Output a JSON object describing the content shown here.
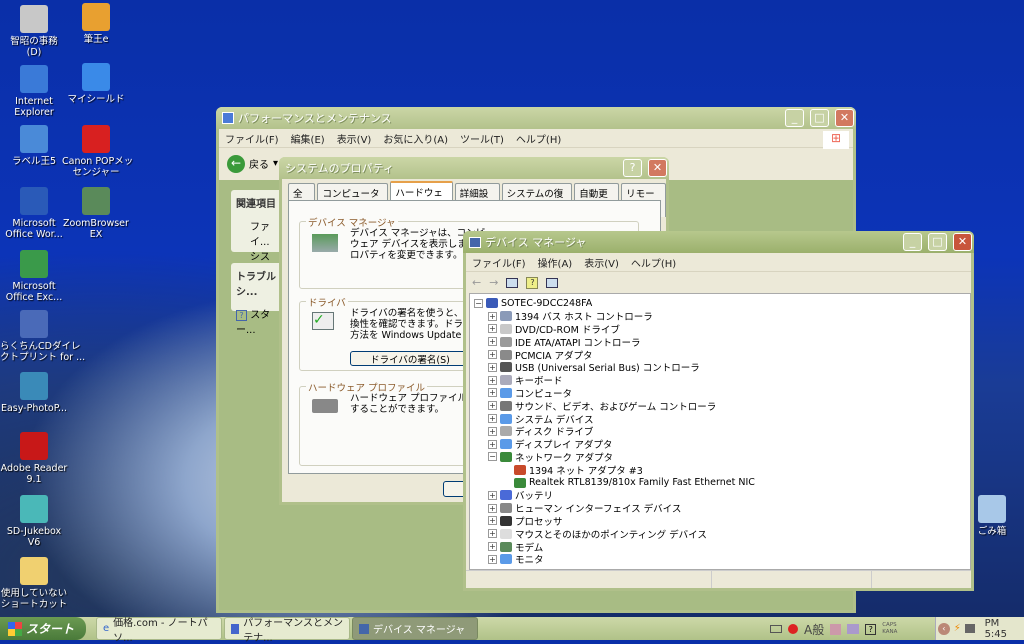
{
  "desktop_icons": [
    {
      "label": "智昭の事務\n(D)",
      "color": "#c8c8c8"
    },
    {
      "label": "Internet\nExplorer",
      "color": "#3a7ad8"
    },
    {
      "label": "ラベル王5",
      "color": "#4a8ad8"
    },
    {
      "label": "Microsoft\nOffice Wor...",
      "color": "#2a5ab8"
    },
    {
      "label": "Microsoft\nOffice Exc...",
      "color": "#3a9a4a"
    },
    {
      "label": "らくちんCDダイレ\nクトプリント for ...",
      "color": "#4a6ab8"
    },
    {
      "label": "Easy-PhotoP...",
      "color": "#3a8ab8"
    },
    {
      "label": "Adobe Reader\n9.1",
      "color": "#c81818"
    },
    {
      "label": "SD-Jukebox\nV6",
      "color": "#4ab8b8"
    },
    {
      "label": "使用していない\nショートカット",
      "color": "#f0d070"
    },
    {
      "label": "筆王e",
      "color": "#e8a030"
    },
    {
      "label": "マイシールド",
      "color": "#3a8ae8"
    },
    {
      "label": "Canon POPメッ\nセンジャー",
      "color": "#d82020"
    },
    {
      "label": "ZoomBrowser\nEX",
      "color": "#5a8a5a"
    },
    {
      "label": "ごみ箱",
      "color": "#a8c8e8"
    }
  ],
  "perf_window": {
    "title": "パフォーマンスとメンテナンス",
    "menu": [
      "ファイル(F)",
      "編集(E)",
      "表示(V)",
      "お気に入り(A)",
      "ツール(T)",
      "ヘルプ(H)"
    ],
    "back": "戻る",
    "related_title": "関連項目",
    "related_items": [
      "ファイ...",
      "システ..."
    ],
    "trouble_title": "トラブルシ...",
    "trouble_items": [
      "スター..."
    ]
  },
  "sysprop": {
    "title": "システムのプロパティ",
    "tabs": [
      "全般",
      "コンピュータ名",
      "ハードウェア",
      "詳細設定",
      "システムの復元",
      "自動更新",
      "リモート"
    ],
    "selected_tab": "ハードウェア",
    "devmgr_group": "デバイス マネージャ",
    "devmgr_text": "デバイス マネージャは、コンピュ\nウェア デバイスを表示します。デ\nロパティを変更できます。",
    "driver_group": "ドライバ",
    "driver_text": "ドライバの署名を使うと、インス\n換性を確認できます。ドライバ\n方法を Windows Update を使",
    "driver_button": "ドライバの署名(S)",
    "profile_group": "ハードウェア プロファイル",
    "profile_text": "ハードウェア プロファイルを使うと\nすることができます。"
  },
  "devmgr": {
    "title": "デバイス マネージャ",
    "menu": [
      "ファイル(F)",
      "操作(A)",
      "表示(V)",
      "ヘルプ(H)"
    ],
    "root": "SOTEC-9DCC248FA",
    "nodes": [
      {
        "label": "1394 バス ホスト コントローラ",
        "color": "#8a9ab8"
      },
      {
        "label": "DVD/CD-ROM ドライブ",
        "color": "#c8c8c8"
      },
      {
        "label": "IDE ATA/ATAPI コントローラ",
        "color": "#9a9a9a"
      },
      {
        "label": "PCMCIA アダプタ",
        "color": "#8a8a8a"
      },
      {
        "label": "USB (Universal Serial Bus) コントローラ",
        "color": "#555"
      },
      {
        "label": "キーボード",
        "color": "#aab"
      },
      {
        "label": "コンピュータ",
        "color": "#5a9ae8"
      },
      {
        "label": "サウンド、ビデオ、およびゲーム コントローラ",
        "color": "#777"
      },
      {
        "label": "システム デバイス",
        "color": "#5a9ae8"
      },
      {
        "label": "ディスク ドライブ",
        "color": "#aaa"
      },
      {
        "label": "ディスプレイ アダプタ",
        "color": "#5a9ae8"
      },
      {
        "label": "ネットワーク アダプタ",
        "color": "#3a8a3a",
        "expanded": true,
        "children": [
          {
            "label": "1394 ネット アダプタ #3",
            "color": "#c84a2a"
          },
          {
            "label": "Realtek RTL8139/810x Family Fast Ethernet NIC",
            "color": "#3a8a3a"
          }
        ]
      },
      {
        "label": "バッテリ",
        "color": "#4a6ad8"
      },
      {
        "label": "ヒューマン インターフェイス デバイス",
        "color": "#888"
      },
      {
        "label": "プロセッサ",
        "color": "#333"
      },
      {
        "label": "マウスとそのほかのポインティング デバイス",
        "color": "#ddd"
      },
      {
        "label": "モデム",
        "color": "#5a8a5a"
      },
      {
        "label": "モニタ",
        "color": "#5a9ae8"
      }
    ]
  },
  "taskbar": {
    "start": "スタート",
    "tasks": [
      "価格.com - ノートパソ...",
      "パフォーマンスとメンテナ...",
      "デバイス マネージャ"
    ],
    "ime": "A般",
    "caps": "CAPS",
    "kana": "KANA",
    "clock": "PM 5:45"
  }
}
